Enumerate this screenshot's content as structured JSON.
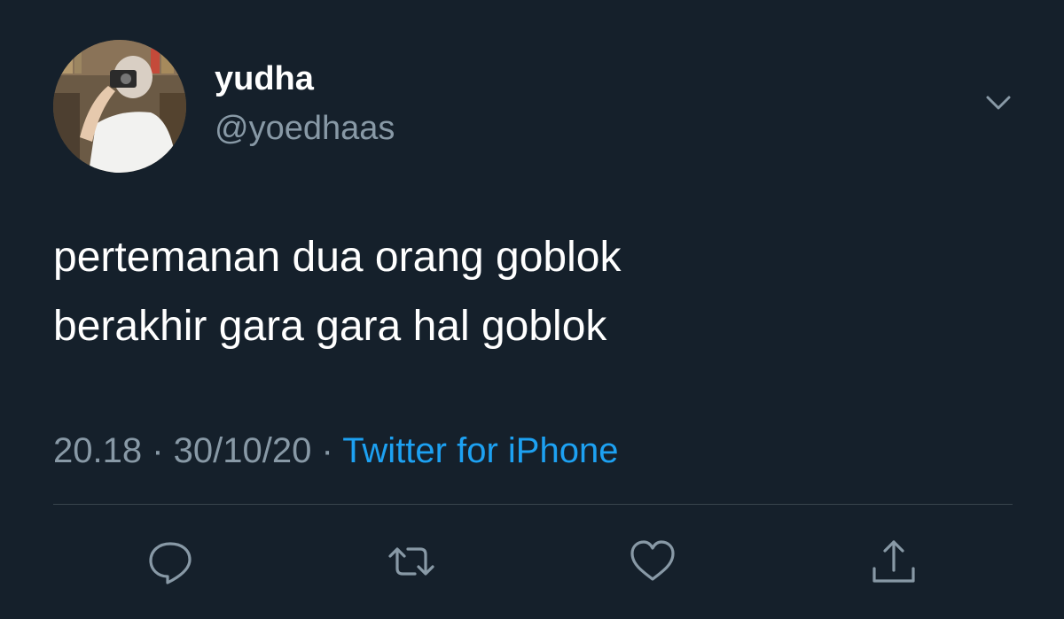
{
  "author": {
    "display_name": "yudha",
    "handle": "@yoedhaas"
  },
  "tweet": {
    "lines": [
      "pertemanan dua orang goblok",
      "berakhir gara gara hal goblok"
    ]
  },
  "meta": {
    "time": "20.18",
    "separator_1": " · ",
    "date": "30/10/20",
    "separator_2": " · ",
    "source": "Twitter for iPhone"
  },
  "icons": {
    "more": "chevron-down-icon",
    "reply": "reply-icon",
    "retweet": "retweet-icon",
    "like": "heart-icon",
    "share": "share-icon"
  },
  "colors": {
    "background": "#15202b",
    "primary_text": "#ffffff",
    "secondary_text": "#8899a6",
    "link": "#1da1f2",
    "divider": "#38444d"
  }
}
